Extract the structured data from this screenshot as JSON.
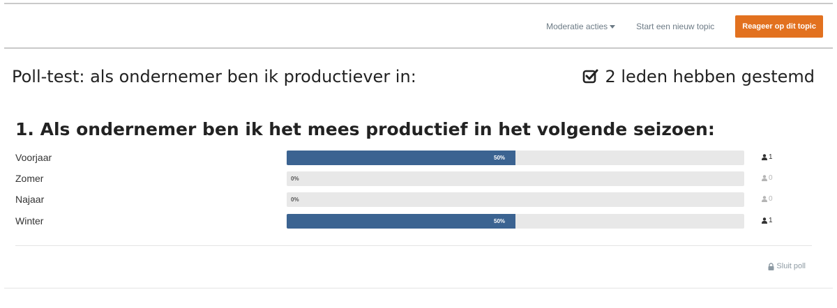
{
  "toolbar": {
    "moderation_label": "Moderatie acties",
    "new_topic_label": "Start een nieuw topic",
    "reply_label": "Reageer op dit topic"
  },
  "poll": {
    "title": "Poll-test: als ondernemer ben ik productiever in:",
    "votes_label": "2 leden hebben gestemd",
    "question": "1. Als ondernemer ben ik het mees productief in het volgende seizoen:",
    "options": [
      {
        "label": "Voorjaar",
        "percent": 50,
        "percent_label": "50%",
        "count": "1"
      },
      {
        "label": "Zomer",
        "percent": 0,
        "percent_label": "0%",
        "count": "0"
      },
      {
        "label": "Najaar",
        "percent": 0,
        "percent_label": "0%",
        "count": "0"
      },
      {
        "label": "Winter",
        "percent": 50,
        "percent_label": "50%",
        "count": "1"
      }
    ],
    "close_label": "Sluit poll"
  },
  "colors": {
    "accent": "#e2711f",
    "bar_fill": "#3b6391",
    "bar_track": "#e8e8e8",
    "count_active": "#333333",
    "count_inactive": "#b5b5b5"
  },
  "icons": {
    "votes": "check-square-icon",
    "count": "user-icon",
    "close": "lock-icon",
    "dropdown": "caret-down-icon"
  }
}
